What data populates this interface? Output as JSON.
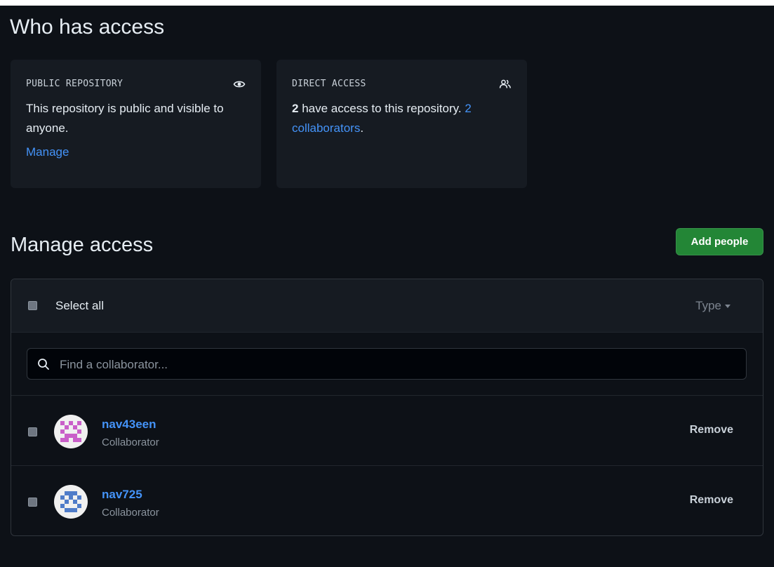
{
  "who_has_access": {
    "heading": "Who has access",
    "public_card": {
      "title": "PUBLIC REPOSITORY",
      "icon": "eye-icon",
      "text": "This repository is public and visible to anyone.",
      "manage_link": "Manage"
    },
    "direct_card": {
      "title": "DIRECT ACCESS",
      "icon": "people-icon",
      "count": "2",
      "text_middle": " have access to this repository. ",
      "collaborators_link": "2 collaborators",
      "text_end": "."
    }
  },
  "manage_access": {
    "heading": "Manage access",
    "add_button": "Add people",
    "select_all_label": "Select all",
    "type_filter": "Type",
    "search_placeholder": "Find a collaborator...",
    "collaborators": [
      {
        "username": "nav43een",
        "role": "Collaborator",
        "remove_label": "Remove",
        "avatar_color": "#c95fc9"
      },
      {
        "username": "nav725",
        "role": "Collaborator",
        "remove_label": "Remove",
        "avatar_color": "#4f7cc9"
      }
    ]
  },
  "colors": {
    "background": "#0d1117",
    "card_background": "#161b22",
    "link": "#4493f8",
    "primary_button": "#238636"
  }
}
